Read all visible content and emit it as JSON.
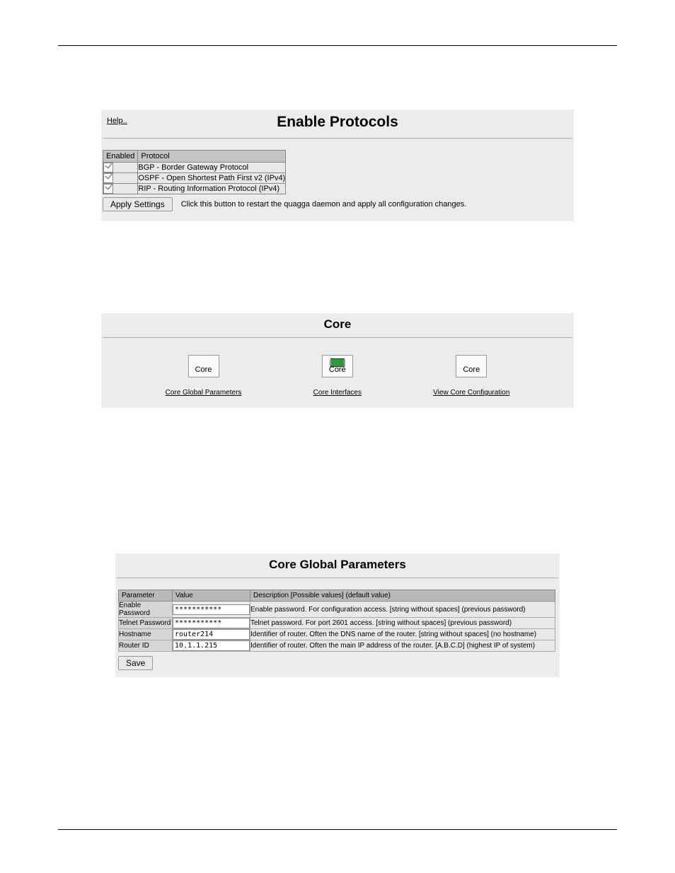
{
  "section1": {
    "help_label": "Help..",
    "title": "Enable Protocols",
    "table": {
      "header_enabled": "Enabled",
      "header_protocol": "Protocol",
      "rows": [
        {
          "protocol": "BGP - Border Gateway Protocol"
        },
        {
          "protocol": "OSPF - Open Shortest Path First v2 (IPv4)"
        },
        {
          "protocol": "RIP - Routing Information Protocol (IPv4)"
        }
      ]
    },
    "apply_button": "Apply Settings",
    "apply_hint": "Click this button to restart the quagga daemon and apply all configuration changes."
  },
  "section2": {
    "title": "Core",
    "items": [
      {
        "icon_text": "Core",
        "link": "Core Global Parameters"
      },
      {
        "icon_text": "Core",
        "link": "Core Interfaces"
      },
      {
        "icon_text": "Core",
        "link": "View Core Configuration"
      }
    ]
  },
  "section3": {
    "title": "Core Global Parameters",
    "table": {
      "header_param": "Parameter",
      "header_value": "Value",
      "header_desc": "Description [Possible values] (default value)",
      "rows": [
        {
          "param": "Enable Password",
          "value": "***********",
          "desc": "Enable password. For configuration access. [string without spaces] (previous password)"
        },
        {
          "param": "Telnet Password",
          "value": "***********",
          "desc": "Telnet password. For port 2601 access. [string without spaces] (previous password)"
        },
        {
          "param": "Hostname",
          "value": "router214",
          "desc": "Identifier of router. Often the DNS name of the router. [string without spaces] (no hostname)"
        },
        {
          "param": "Router ID",
          "value": "10.1.1.215",
          "desc": "Identifier of router. Often the main IP address of the router. [A.B.C.D] (highest IP of system)"
        }
      ]
    },
    "save_button": "Save"
  }
}
